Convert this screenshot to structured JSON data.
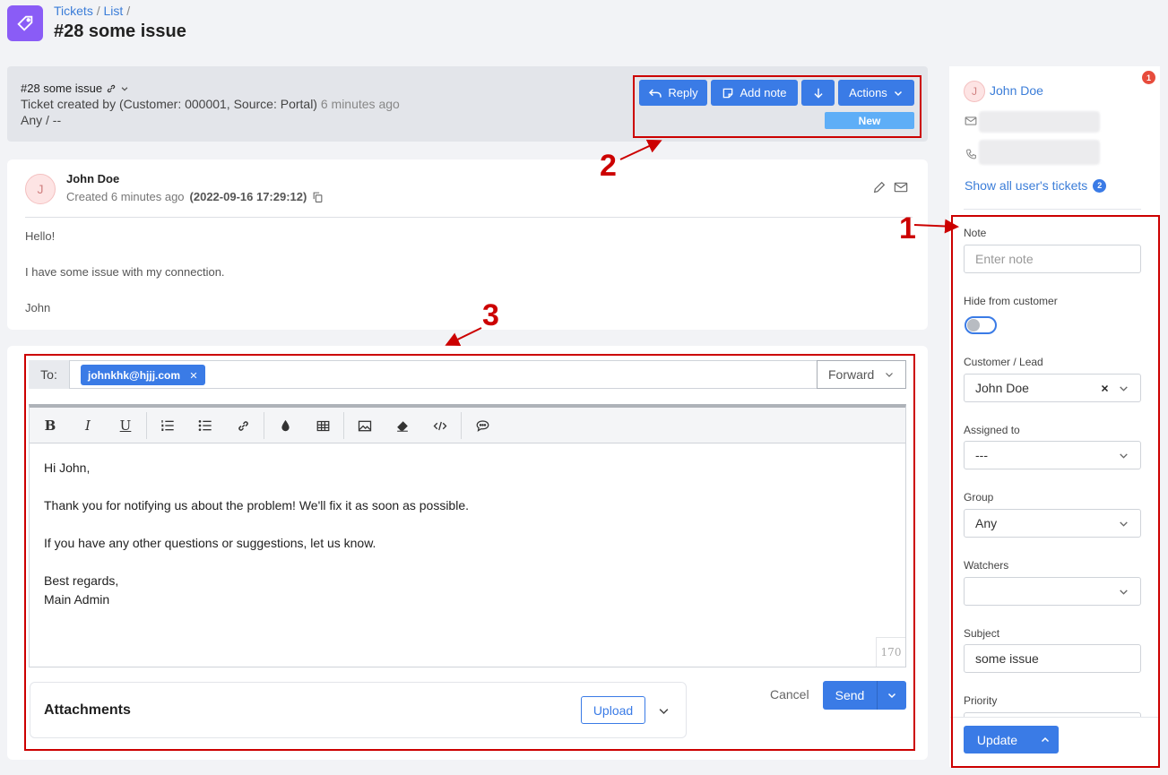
{
  "breadcrumb": {
    "tickets": "Tickets",
    "sep1": "/",
    "list": "List",
    "sep2": "/"
  },
  "page_title": "#28 some issue",
  "ticket": {
    "title": "#28 some issue",
    "created_text": "Ticket created by (Customer: 000001, Source: Portal)",
    "created_ago": "6 minutes ago",
    "group_line": "Any / --",
    "status": "New"
  },
  "actions": {
    "reply": "Reply",
    "add_note": "Add note",
    "actions": "Actions"
  },
  "message": {
    "avatar_letter": "J",
    "author": "John Doe",
    "created_prefix": "Created 6 minutes ago",
    "created_date": "(2022-09-16 17:29:12)",
    "lines": [
      "Hello!",
      "I have some issue with my connection.",
      "John"
    ]
  },
  "reply": {
    "to_label": "To:",
    "recipient": "johnkhk@hjjj.com",
    "mode": "Forward",
    "body": [
      "Hi John,",
      "Thank you for notifying us about the problem! We'll fix it as soon as possible.",
      "If you have any other questions or suggestions, let us know.",
      "Best regards,",
      "Main Admin"
    ],
    "char_count": "170",
    "attachments_label": "Attachments",
    "upload": "Upload",
    "cancel": "Cancel",
    "send": "Send"
  },
  "sidebar": {
    "user_letter": "J",
    "user_name": "John Doe",
    "notifications": "1",
    "show_all": "Show all user's tickets",
    "show_all_count": "2",
    "note_label": "Note",
    "note_placeholder": "Enter note",
    "hide_label": "Hide from customer",
    "customer_label": "Customer / Lead",
    "customer_value": "John Doe",
    "assigned_label": "Assigned to",
    "assigned_value": "---",
    "group_label": "Group",
    "group_value": "Any",
    "watchers_label": "Watchers",
    "watchers_value": "",
    "subject_label": "Subject",
    "subject_value": "some issue",
    "priority_label": "Priority",
    "update": "Update"
  },
  "annotations": {
    "n1": "1",
    "n2": "2",
    "n3": "3"
  },
  "colors": {
    "primary": "#3a7be6",
    "accent": "#8a5cf6",
    "status_new": "#5eaef7",
    "annotation": "#cc0000"
  }
}
